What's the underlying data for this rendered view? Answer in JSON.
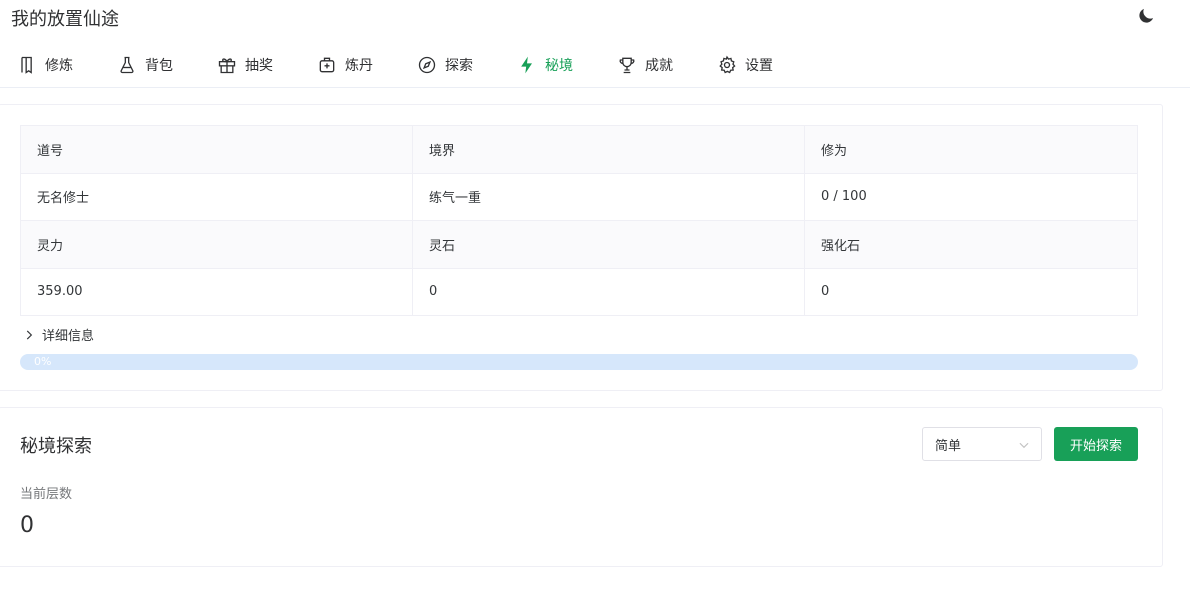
{
  "app": {
    "title": "我的放置仙途"
  },
  "nav": {
    "items": [
      {
        "label": "修炼",
        "icon": "book-icon"
      },
      {
        "label": "背包",
        "icon": "flask-icon"
      },
      {
        "label": "抽奖",
        "icon": "gift-icon"
      },
      {
        "label": "炼丹",
        "icon": "medkit-icon"
      },
      {
        "label": "探索",
        "icon": "compass-icon"
      },
      {
        "label": "秘境",
        "icon": "bolt-icon",
        "active": true
      },
      {
        "label": "成就",
        "icon": "trophy-icon"
      },
      {
        "label": "设置",
        "icon": "gear-icon"
      }
    ],
    "active_color": "#18a058"
  },
  "stats": {
    "headers1": [
      "道号",
      "境界",
      "修为"
    ],
    "values1": [
      "无名修士",
      "练气一重",
      "0 / 100"
    ],
    "headers2": [
      "灵力",
      "灵石",
      "强化石"
    ],
    "values2": [
      "359.00",
      "0",
      "0"
    ]
  },
  "details": {
    "label": "详细信息"
  },
  "progress": {
    "percent": 0,
    "label": "0%"
  },
  "realm": {
    "title": "秘境探索",
    "difficulty": "简单",
    "start_label": "开始探索",
    "floor_label": "当前层数",
    "floor_value": "0"
  },
  "colors": {
    "primary": "#18a058",
    "progress_track": "#d6e7fb"
  }
}
